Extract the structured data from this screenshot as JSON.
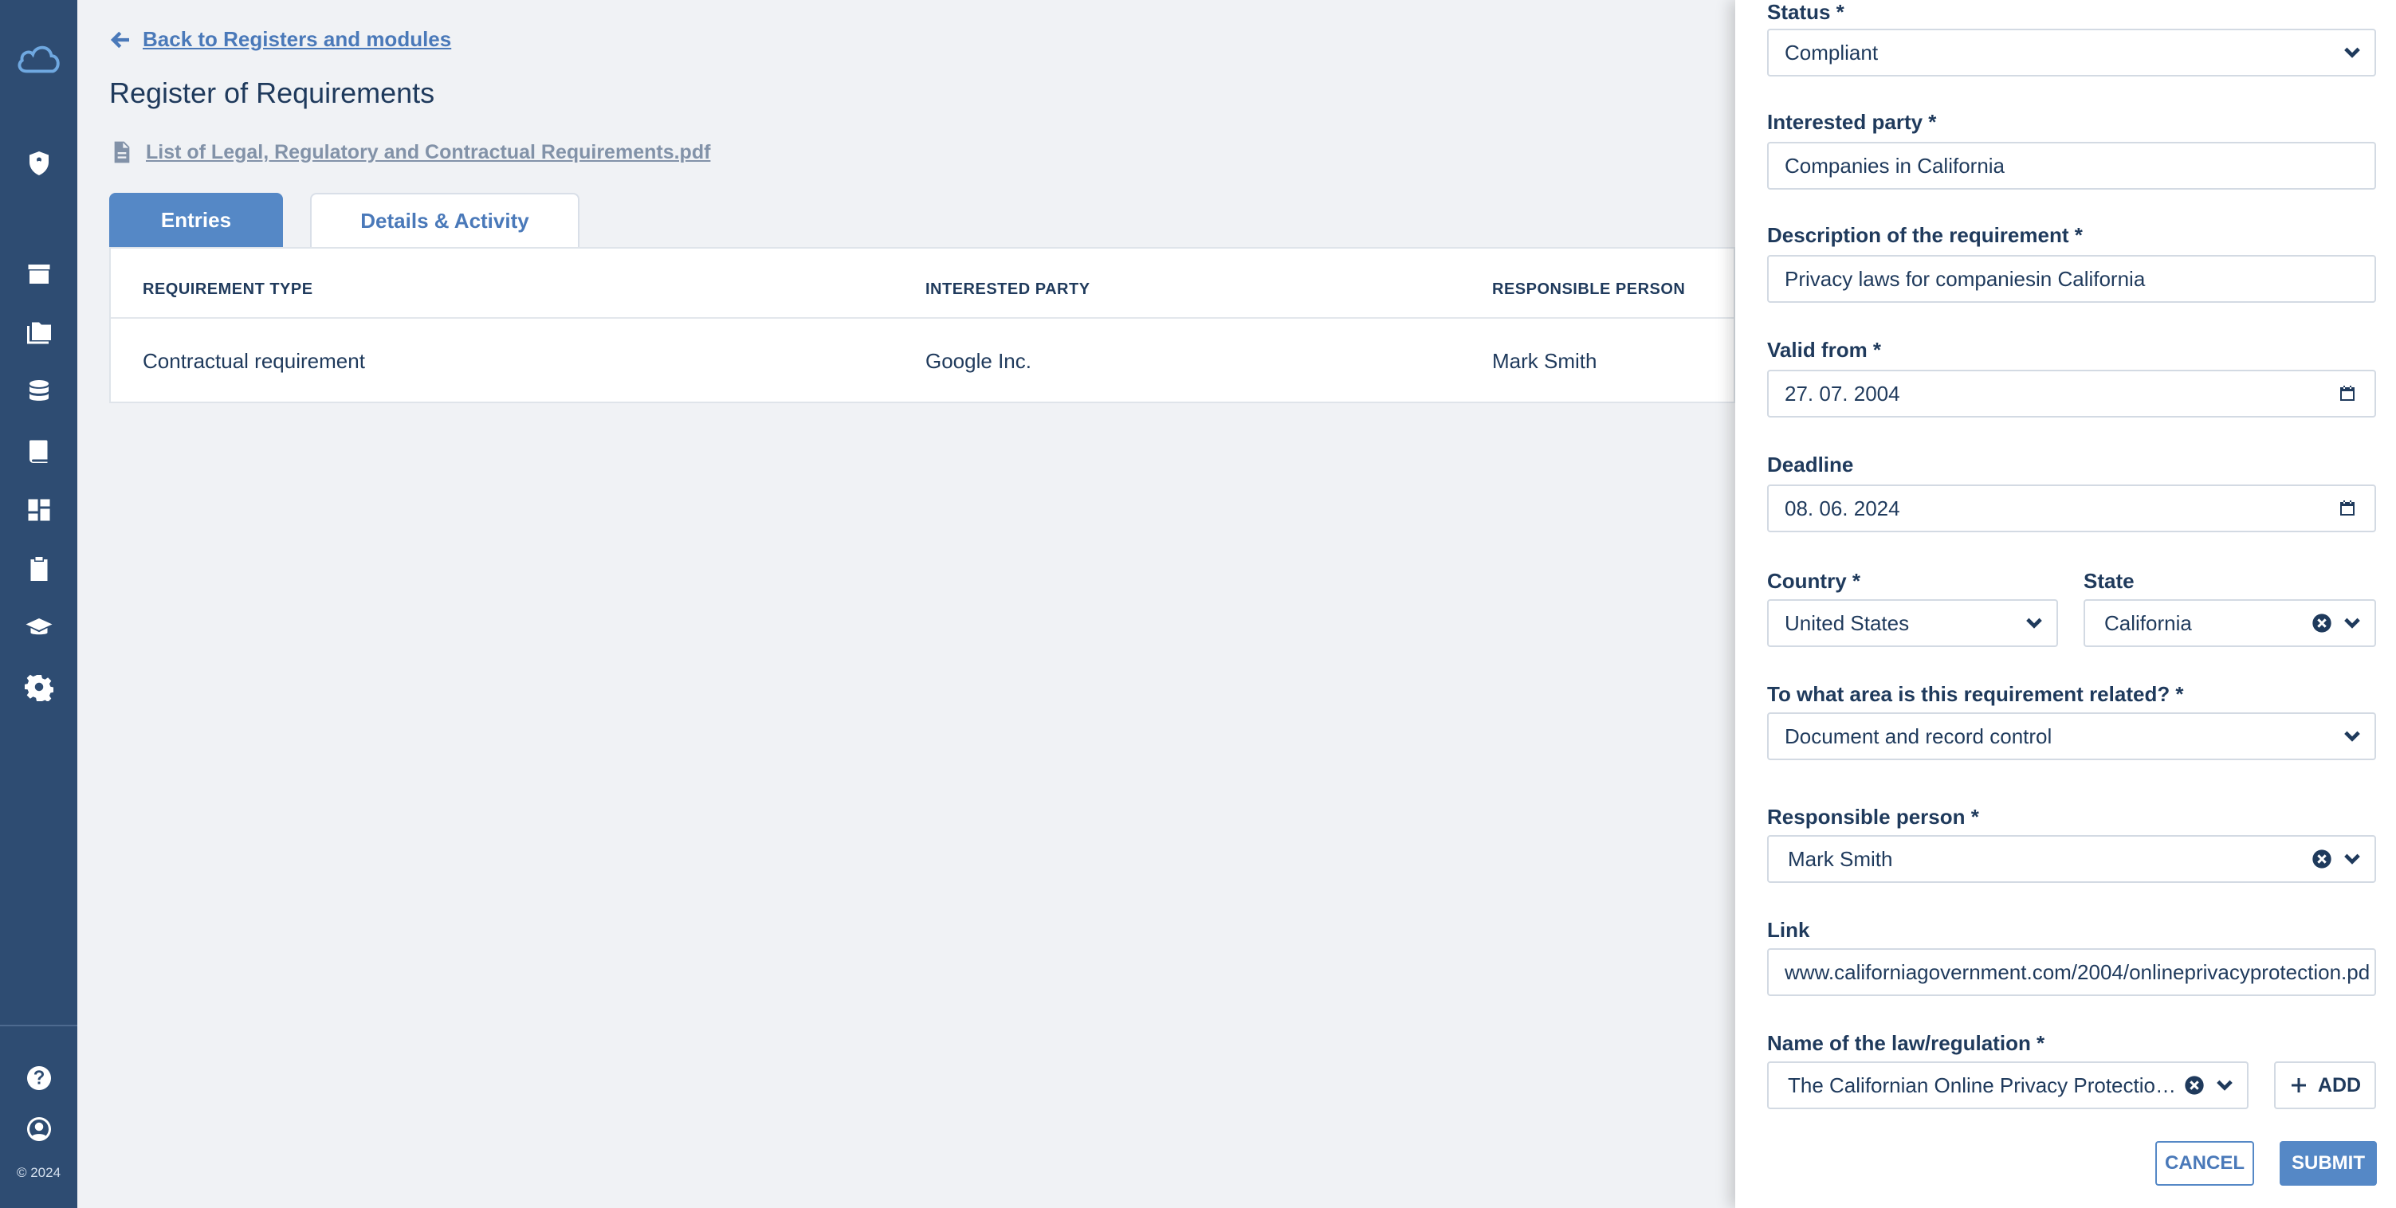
{
  "sidebar": {
    "icons": [
      "cloud-logo-icon",
      "shield-icon",
      "archive-icon",
      "folders-icon",
      "database-icon",
      "book-icon",
      "dashboard-icon",
      "clipboard-icon",
      "graduation-cap-icon",
      "gear-icon",
      "help-icon",
      "account-icon"
    ],
    "copyright": "© 2024"
  },
  "main": {
    "back_link": "Back to Registers and modules",
    "page_title": "Register of Requirements",
    "document_link": "List of Legal, Regulatory and Contractual Requirements.pdf",
    "tabs": [
      {
        "label": "Entries",
        "active": true
      },
      {
        "label": "Details & Activity",
        "active": false
      }
    ],
    "table": {
      "headers": [
        "REQUIREMENT TYPE",
        "INTERESTED PARTY",
        "RESPONSIBLE PERSON"
      ],
      "rows": [
        [
          "Contractual requirement",
          "Google Inc.",
          "Mark Smith"
        ]
      ]
    }
  },
  "form": {
    "status": {
      "label": "Status *",
      "value": "Compliant"
    },
    "interested_party": {
      "label": "Interested party *",
      "value": "Companies in California"
    },
    "description": {
      "label": "Description of the requirement *",
      "value": "Privacy laws for companiesin California"
    },
    "valid_from": {
      "label": "Valid from *",
      "value": "27. 07. 2004"
    },
    "deadline": {
      "label": "Deadline",
      "value": "08. 06. 2024"
    },
    "country": {
      "label": "Country *",
      "value": "United States"
    },
    "state": {
      "label": "State",
      "value": "California"
    },
    "area": {
      "label": "To what area is this requirement related? *",
      "value": "Document and record control"
    },
    "responsible_person": {
      "label": "Responsible person *",
      "value": "Mark Smith"
    },
    "link": {
      "label": "Link",
      "value": "www.californiagovernment.com/2004/onlineprivacyprotection.pd"
    },
    "law_name": {
      "label": "Name of the law/regulation *",
      "value": "The Californian Online Privacy Protection ..."
    },
    "add_label": "ADD",
    "cancel_label": "CANCEL",
    "submit_label": "SUBMIT"
  },
  "colors": {
    "sidebar": "#2e4c72",
    "accent": "#5588c6",
    "text": "#1f3a5c",
    "background": "#f0f2f5"
  }
}
